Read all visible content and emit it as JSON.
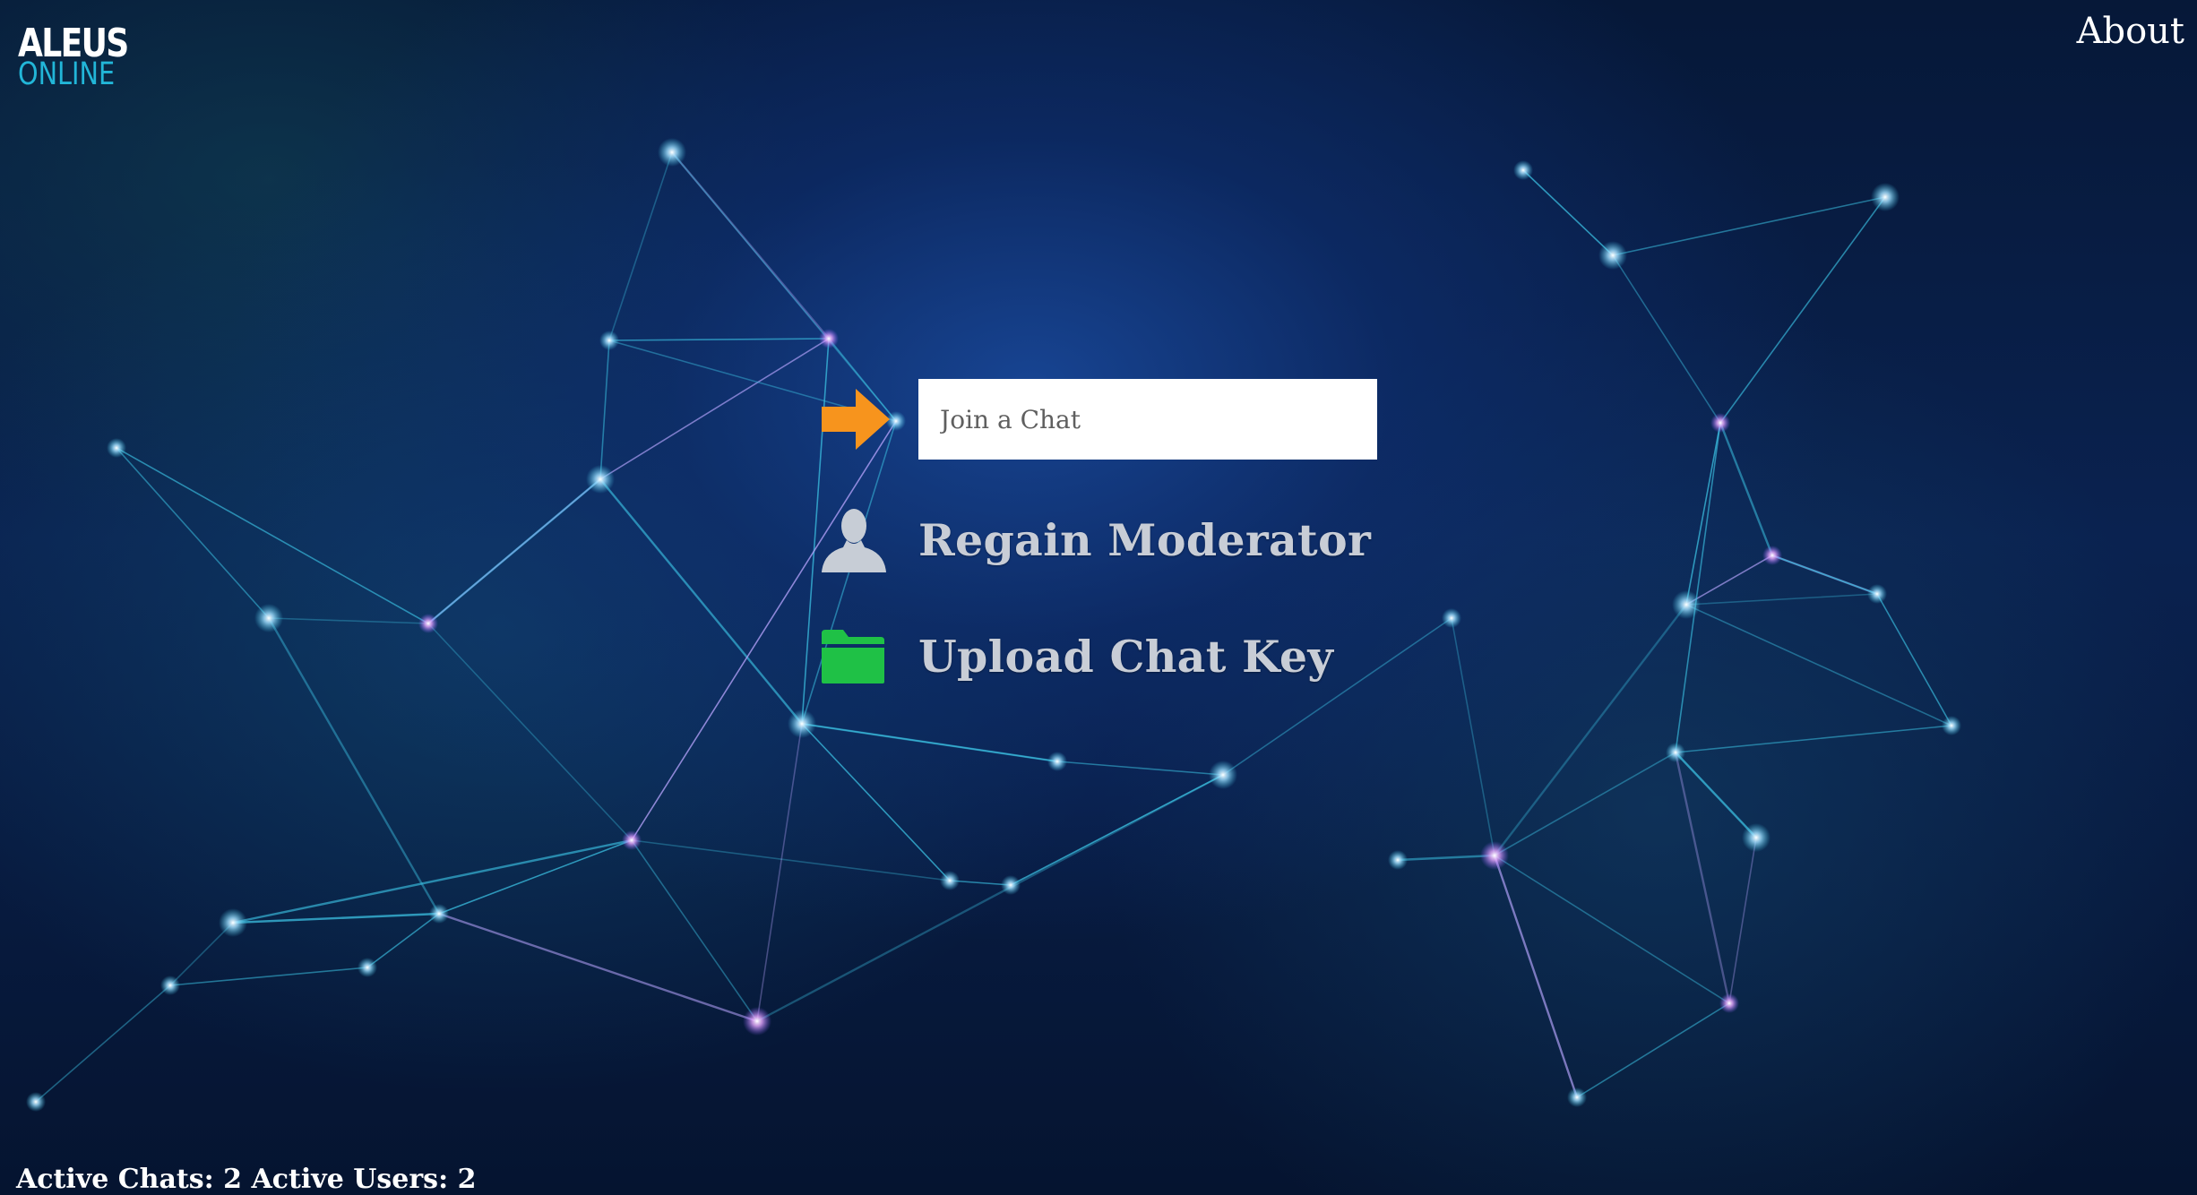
{
  "brand": {
    "logo_top": "ALEUS",
    "logo_bottom": "ONLINE"
  },
  "nav": {
    "about_label": "About"
  },
  "menu": {
    "join": {
      "placeholder": "Join a Chat",
      "value": "",
      "icon": "arrow-right-icon",
      "icon_color": "#f7941d"
    },
    "regain_moderator": {
      "label": "Regain Moderator",
      "icon": "user-icon",
      "icon_color": "#c7cdd6"
    },
    "upload_key": {
      "label": "Upload Chat Key",
      "icon": "folder-icon",
      "icon_color": "#1fc146"
    }
  },
  "footer": {
    "status": "Active Chats: 2 Active Users: 2"
  },
  "colors": {
    "background": "#061838",
    "network_line": "#3bbfe0",
    "node_glow": "#bfe9ff",
    "logo_accent": "#22b6d8"
  }
}
